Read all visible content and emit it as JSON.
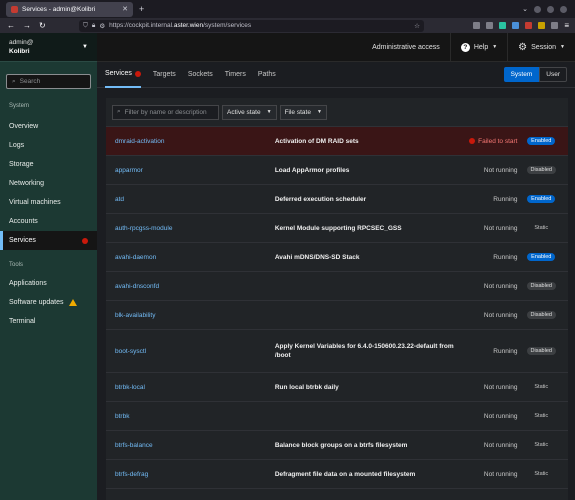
{
  "browser": {
    "tab_title": "Services - admin@Kolibri",
    "url_prefix": "https://cockpit.internal.",
    "url_host": "aster.wien",
    "url_path": "/system/services"
  },
  "host": {
    "user": "admin@",
    "name": "Kolibri"
  },
  "sidebar": {
    "search_placeholder": "Search",
    "system_label": "System",
    "system_items": [
      {
        "label": "Overview"
      },
      {
        "label": "Logs"
      },
      {
        "label": "Storage"
      },
      {
        "label": "Networking"
      },
      {
        "label": "Virtual machines"
      },
      {
        "label": "Accounts"
      },
      {
        "label": "Services"
      }
    ],
    "tools_label": "Tools",
    "tools_items": [
      {
        "label": "Applications"
      },
      {
        "label": "Software updates"
      },
      {
        "label": "Terminal"
      }
    ]
  },
  "masthead": {
    "admin_access": "Administrative access",
    "help": "Help",
    "session": "Session"
  },
  "tabs": [
    {
      "label": "Services"
    },
    {
      "label": "Targets"
    },
    {
      "label": "Sockets"
    },
    {
      "label": "Timers"
    },
    {
      "label": "Paths"
    }
  ],
  "scope": {
    "system": "System",
    "user": "User"
  },
  "toolbar": {
    "filter_placeholder": "Filter by name or description",
    "active_state": "Active state",
    "file_state": "File state"
  },
  "colors": {
    "accent": "#0066cc",
    "link": "#73bcf7",
    "danger": "#c9190b",
    "sidebar": "#1c3933"
  },
  "services": [
    {
      "unit": "dmraid-activation",
      "desc": "Activation of DM RAID sets",
      "state": "Failed to start",
      "file": "Enabled"
    },
    {
      "unit": "apparmor",
      "desc": "Load AppArmor profiles",
      "state": "Not running",
      "file": "Disabled"
    },
    {
      "unit": "atd",
      "desc": "Deferred execution scheduler",
      "state": "Running",
      "file": "Enabled"
    },
    {
      "unit": "auth-rpcgss-module",
      "desc": "Kernel Module supporting RPCSEC_GSS",
      "state": "Not running",
      "file": "Static"
    },
    {
      "unit": "avahi-daemon",
      "desc": "Avahi mDNS/DNS-SD Stack",
      "state": "Running",
      "file": "Enabled"
    },
    {
      "unit": "avahi-dnsconfd",
      "desc": "",
      "state": "Not running",
      "file": "Disabled"
    },
    {
      "unit": "blk-availability",
      "desc": "",
      "state": "Not running",
      "file": "Disabled"
    },
    {
      "unit": "boot-sysctl",
      "desc": "Apply Kernel Variables for 6.4.0-150600.23.22-default from /boot",
      "state": "Running",
      "file": "Disabled"
    },
    {
      "unit": "btrbk-local",
      "desc": "Run local btrbk daily",
      "state": "Not running",
      "file": "Static"
    },
    {
      "unit": "btrbk",
      "desc": "",
      "state": "Not running",
      "file": "Static"
    },
    {
      "unit": "btrfs-balance",
      "desc": "Balance block groups on a btrfs filesystem",
      "state": "Not running",
      "file": "Static"
    },
    {
      "unit": "btrfs-defrag",
      "desc": "Defragment file data on a mounted filesystem",
      "state": "Not running",
      "file": "Static"
    }
  ]
}
